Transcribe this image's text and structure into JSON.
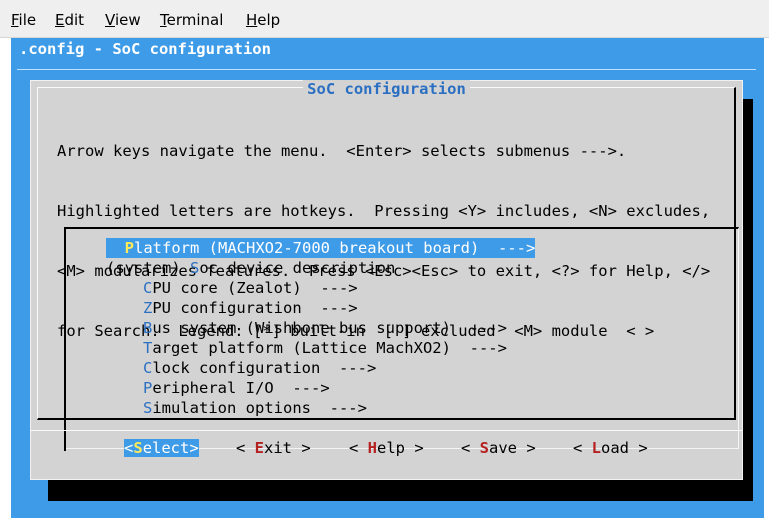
{
  "menubar": {
    "file": {
      "key": "F",
      "rest": "ile"
    },
    "edit": {
      "key": "E",
      "rest": "dit"
    },
    "view": {
      "key": "V",
      "rest": "iew"
    },
    "terminal": {
      "key": "T",
      "rest": "erminal"
    },
    "help": {
      "key": "H",
      "rest": "elp"
    }
  },
  "terminal": {
    "title": ".config - SoC configuration"
  },
  "dialog": {
    "title": "SoC configuration",
    "help_lines": [
      "Arrow keys navigate the menu.  <Enter> selects submenus --->.",
      "Highlighted letters are hotkeys.  Pressing <Y> includes, <N> excludes,",
      "<M> modularizes features.  Press <Esc><Esc> to exit, <?> for Help, </>",
      "for Search.  Legend: [*] built-in  [ ] excluded  <M> module  < >"
    ],
    "menu": [
      {
        "prefix": "",
        "hotkey": "P",
        "rest": "latform (MACHXO2-7000 breakout board)  --->"
      },
      {
        "prefix": "(system) ",
        "hotkey": "S",
        "rest": "oc device description"
      },
      {
        "prefix": "",
        "hotkey": "C",
        "rest": "PU core (Zealot)  --->"
      },
      {
        "prefix": "",
        "hotkey": "Z",
        "rest": "PU configuration  --->"
      },
      {
        "prefix": "",
        "hotkey": "B",
        "rest": "us system (Wishbone bus support)  --->"
      },
      {
        "prefix": "",
        "hotkey": "T",
        "rest": "arget platform (Lattice MachXO2)  --->"
      },
      {
        "prefix": "",
        "hotkey": "C",
        "rest": "lock configuration  --->"
      },
      {
        "prefix": "",
        "hotkey": "P",
        "rest": "eripheral I/O  --->"
      },
      {
        "prefix": "",
        "hotkey": "S",
        "rest": "imulation options  --->"
      }
    ],
    "buttons": {
      "select": {
        "open": "<",
        "key": "S",
        "rest": "elect>"
      },
      "exit": {
        "open": "< ",
        "key": "E",
        "rest": "xit >"
      },
      "help": {
        "open": "< ",
        "key": "H",
        "rest": "elp >"
      },
      "save": {
        "open": "< ",
        "key": "S",
        "rest": "ave >"
      },
      "load": {
        "open": "< ",
        "key": "L",
        "rest": "oad >"
      }
    }
  },
  "colors": {
    "terminal_bg": "#3e9be8",
    "dialog_bg": "#d3d3d3",
    "hotkey_blue": "#2b6fc2",
    "hotkey_red": "#b52020",
    "selected_hotkey": "#ffeb59"
  }
}
